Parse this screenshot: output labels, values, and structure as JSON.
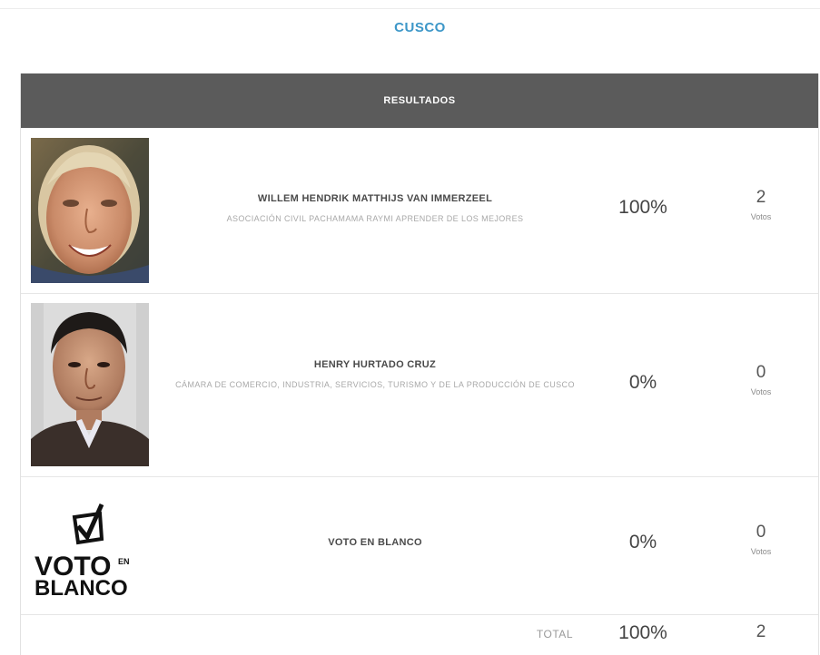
{
  "region": "CUSCO",
  "table": {
    "header": "RESULTADOS",
    "rows": [
      {
        "name": "WILLEM HENDRIK MATTHIJS VAN IMMERZEEL",
        "party": "ASOCIACIÓN CIVIL PACHAMAMA RAYMI APRENDER DE LOS MEJORES",
        "percent": "100%",
        "votes": "2",
        "votes_label": "Votos"
      },
      {
        "name": "HENRY HURTADO CRUZ",
        "party": "CÁMARA DE COMERCIO, INDUSTRIA, SERVICIOS, TURISMO Y DE LA PRODUCCIÓN DE CUSCO",
        "percent": "0%",
        "votes": "0",
        "votes_label": "Votos"
      },
      {
        "name": "VOTO EN BLANCO",
        "percent": "0%",
        "votes": "0",
        "votes_label": "Votos",
        "logo": {
          "line1": "VOTO",
          "en": "EN",
          "line2": "BLANCO"
        }
      }
    ],
    "total": {
      "label": "TOTAL",
      "percent": "100%",
      "votes": "2"
    }
  },
  "icons": [
    "candidate-photo",
    "candidate-photo",
    "voto-en-blanco-logo"
  ]
}
